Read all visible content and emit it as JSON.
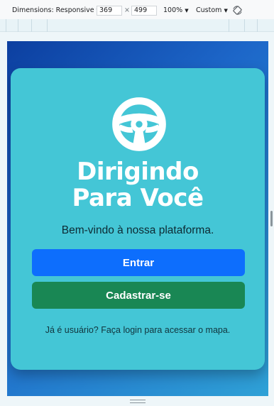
{
  "devtools": {
    "dimensions_label": "Dimensions: Responsive",
    "width_value": "369",
    "times_sign": "×",
    "height_value": "499",
    "zoom_label": "100%",
    "throttle_label": "Custom",
    "rotate_icon": "rotate-icon",
    "chevron_icon": "chevron-down-icon"
  },
  "app": {
    "logo_icon": "steering-wheel-icon",
    "brand_line1": "Dirigindo",
    "brand_line2": "Para Você",
    "welcome_text": "Bem-vindo à nossa plataforma.",
    "login_button": "Entrar",
    "register_button": "Cadastrar-se",
    "note_text": "Já é usuário? Faça login para acessar o mapa.",
    "colors": {
      "card": "#44c6d6",
      "login_button": "#0d6efd",
      "register_button": "#198754",
      "background_start": "#0c3fa0",
      "background_end": "#2fa1d6"
    }
  }
}
